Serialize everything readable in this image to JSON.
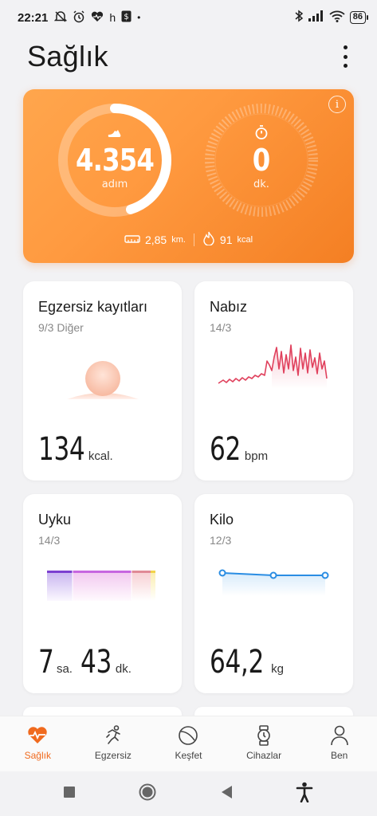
{
  "status": {
    "time": "22:21",
    "notif_h": "h",
    "battery": "86"
  },
  "header": {
    "title": "Sağlık"
  },
  "activity": {
    "steps": "4.354",
    "steps_unit": "adım",
    "steps_progress": 0.45,
    "minutes": "0",
    "minutes_unit": "dk.",
    "distance": "2,85",
    "distance_unit": "km.",
    "calories": "91",
    "calories_unit": "kcal"
  },
  "tiles": {
    "exercise": {
      "title": "Egzersiz kayıtları",
      "sub": "9/3 Diğer",
      "value": "134",
      "unit": "kcal."
    },
    "pulse": {
      "title": "Nabız",
      "sub": "14/3",
      "value": "62",
      "unit": "bpm"
    },
    "sleep": {
      "title": "Uyku",
      "sub": "14/3",
      "hours": "7",
      "hours_unit": "sa.",
      "minutes": "43",
      "minutes_unit": "dk."
    },
    "weight": {
      "title": "Kilo",
      "sub": "12/3",
      "value": "64,2",
      "unit": "kg"
    }
  },
  "nav": {
    "items": [
      {
        "label": "Sağlık",
        "icon": "heart-pulse-icon"
      },
      {
        "label": "Egzersiz",
        "icon": "running-icon"
      },
      {
        "label": "Keşfet",
        "icon": "discover-icon"
      },
      {
        "label": "Cihazlar",
        "icon": "watch-icon"
      },
      {
        "label": "Ben",
        "icon": "person-icon"
      }
    ]
  },
  "colors": {
    "accent": "#f06a1e",
    "card_orange": "#f88a30",
    "pulse": "#e0415d",
    "sleep_deep": "#7b3fd0",
    "weight_line": "#2a8de3"
  }
}
